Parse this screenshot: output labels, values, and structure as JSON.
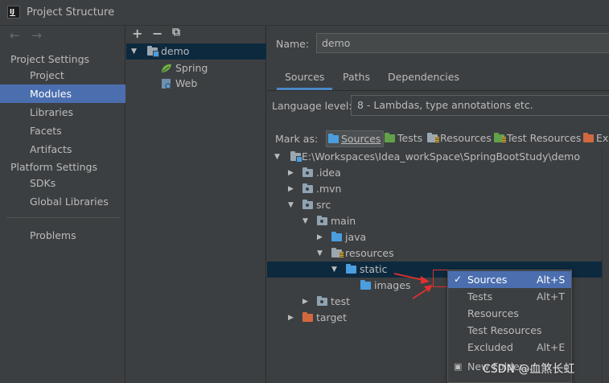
{
  "window": {
    "title": "Project Structure",
    "app_icon": "IJ"
  },
  "nav": {
    "back": "←",
    "forward": "→",
    "project_settings_heading": "Project Settings",
    "platform_settings_heading": "Platform Settings",
    "items": [
      "Project",
      "Modules",
      "Libraries",
      "Facets",
      "Artifacts"
    ],
    "platform_items": [
      "SDKs",
      "Global Libraries"
    ],
    "problems": "Problems",
    "selected": "Modules"
  },
  "module_tree": {
    "toolbar": {
      "add": "+",
      "remove": "−",
      "copy": "⧉"
    },
    "root": "demo",
    "children": [
      "Spring",
      "Web"
    ]
  },
  "detail": {
    "name_label": "Name:",
    "name_value": "demo",
    "tabs": [
      "Sources",
      "Paths",
      "Dependencies"
    ],
    "active_tab": "Sources",
    "language_level_label": "Language level:",
    "language_level_value": "8 - Lambdas, type annotations etc.",
    "mark_as_label": "Mark as:",
    "mark_buttons": [
      "Sources",
      "Tests",
      "Resources",
      "Test Resources",
      "Exc"
    ]
  },
  "file_tree": [
    {
      "label": "E:\\Workspaces\\Idea_workSpace\\SpringBootStudy\\demo",
      "depth": 0,
      "arrow": "down",
      "icon": "folder-module"
    },
    {
      "label": ".idea",
      "depth": 1,
      "arrow": "right",
      "icon": "folder-grey"
    },
    {
      "label": ".mvn",
      "depth": 1,
      "arrow": "right",
      "icon": "folder-grey"
    },
    {
      "label": "src",
      "depth": 1,
      "arrow": "down",
      "icon": "folder-grey"
    },
    {
      "label": "main",
      "depth": 2,
      "arrow": "down",
      "icon": "folder-grey"
    },
    {
      "label": "java",
      "depth": 3,
      "arrow": "right",
      "icon": "folder-blue"
    },
    {
      "label": "resources",
      "depth": 3,
      "arrow": "down",
      "icon": "folder-resources"
    },
    {
      "label": "static",
      "depth": 4,
      "arrow": "down",
      "icon": "folder-blue",
      "selected": true
    },
    {
      "label": "images",
      "depth": 5,
      "arrow": "",
      "icon": "folder-blue"
    },
    {
      "label": "test",
      "depth": 1,
      "arrow": "right",
      "icon": "folder-grey",
      "indent_override": 2
    },
    {
      "label": "target",
      "depth": 1,
      "arrow": "right",
      "icon": "folder-orange"
    }
  ],
  "context_menu": {
    "items": [
      {
        "label": "Sources",
        "shortcut": "Alt+S",
        "checked": true,
        "selected": true
      },
      {
        "label": "Tests",
        "shortcut": "Alt+T",
        "checked": false,
        "selected": false
      },
      {
        "label": "Resources",
        "shortcut": "",
        "checked": false,
        "selected": false
      },
      {
        "label": "Test Resources",
        "shortcut": "",
        "checked": false,
        "selected": false
      },
      {
        "label": "Excluded",
        "shortcut": "Alt+E",
        "checked": false,
        "selected": false
      },
      {
        "label": "New Folder...",
        "shortcut": "",
        "checked": false,
        "selected": false
      }
    ]
  },
  "watermark": "CSDN @血煞长虹",
  "colors": {
    "accent": "#4b6eaf",
    "selection": "#0d293e",
    "annotation_red": "#e03030"
  }
}
